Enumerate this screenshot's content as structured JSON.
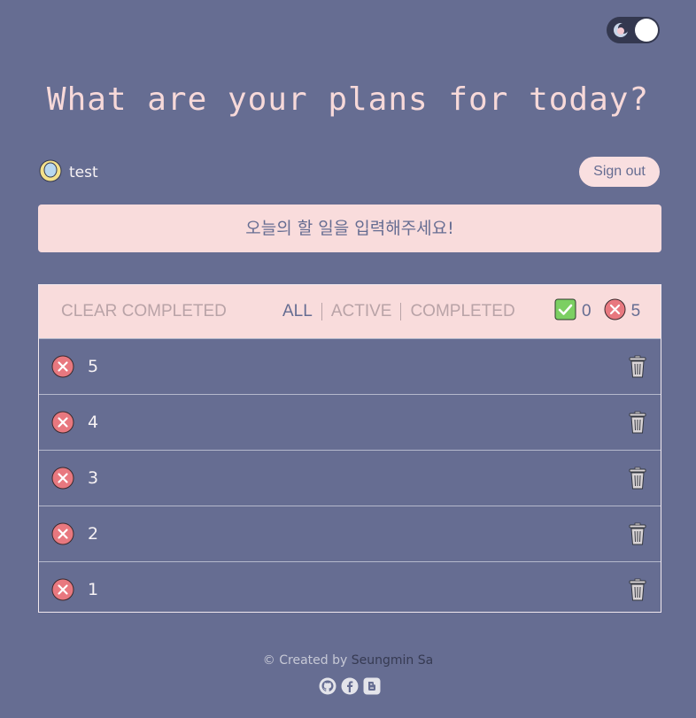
{
  "header": {
    "title": "What are your plans for today?"
  },
  "theme_toggle": {
    "icon": "moon-icon"
  },
  "user": {
    "name": "test",
    "avatar": "avatar-icon"
  },
  "auth": {
    "sign_out_label": "Sign out"
  },
  "input": {
    "placeholder": "오늘의 할 일을 입력해주세요!"
  },
  "toolbar": {
    "clear_label": "CLEAR COMPLETED",
    "filters": [
      "ALL",
      "ACTIVE",
      "COMPLETED"
    ],
    "active_filter": "ALL",
    "completed_count": "0",
    "active_count": "5"
  },
  "todos": [
    {
      "text": "5",
      "done": false
    },
    {
      "text": "4",
      "done": false
    },
    {
      "text": "3",
      "done": false
    },
    {
      "text": "2",
      "done": false
    },
    {
      "text": "1",
      "done": false
    }
  ],
  "footer": {
    "prefix": "© Created by ",
    "author": "Seungmin Sa"
  },
  "colors": {
    "background": "#666d92",
    "accent": "#f9dcdc",
    "incomplete_red": "#e8787f",
    "complete_green": "#7ccf62"
  }
}
